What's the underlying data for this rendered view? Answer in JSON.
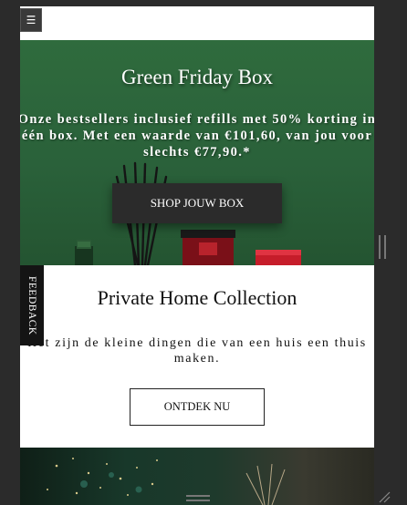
{
  "toolbar": {
    "menu_icon": "☰"
  },
  "hero": {
    "title": "Green Friday Box",
    "text": "Onze bestsellers inclusief refills met 50% korting in één box. Met een waarde van €101,60, van jou voor slechts €77,90.*",
    "cta_label": "SHOP JOUW BOX",
    "background_color": "#2a613a"
  },
  "section2": {
    "title": "Private Home Collection",
    "text": "Het zijn de kleine dingen die van een huis een thuis maken.",
    "cta_label": "ONTDEK NU"
  },
  "feedback": {
    "label": "FEEDBACK"
  },
  "icons": {
    "menu": "hamburger-icon",
    "scroll": "scroll-handle-icon",
    "resize": "resize-grip-icon"
  }
}
